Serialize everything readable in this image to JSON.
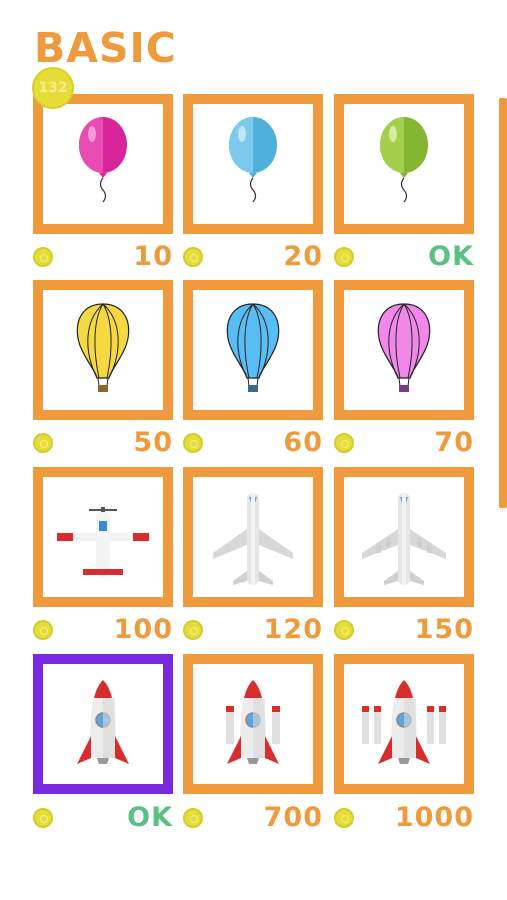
{
  "header": {
    "title": "BASIC",
    "coins": "132"
  },
  "colors": {
    "accent": "#ee9a3d",
    "selected": "#7a28e0",
    "ok": "#5cc080",
    "coin": "#e6dd39"
  },
  "items": [
    {
      "name": "pink-balloon",
      "price": "10",
      "owned": false
    },
    {
      "name": "blue-balloon",
      "price": "20",
      "owned": false
    },
    {
      "name": "green-balloon",
      "price": "OK",
      "owned": true
    },
    {
      "name": "yellow-hot-air-balloon",
      "price": "50",
      "owned": false
    },
    {
      "name": "blue-hot-air-balloon",
      "price": "60",
      "owned": false
    },
    {
      "name": "pink-hot-air-balloon",
      "price": "70",
      "owned": false
    },
    {
      "name": "red-white-propeller-plane",
      "price": "100",
      "owned": false
    },
    {
      "name": "white-jet-plane",
      "price": "120",
      "owned": false
    },
    {
      "name": "white-four-engine-jet",
      "price": "150",
      "owned": false
    },
    {
      "name": "rocket",
      "price": "OK",
      "owned": true,
      "selected": true
    },
    {
      "name": "rocket-two-boosters",
      "price": "700",
      "owned": false
    },
    {
      "name": "rocket-four-boosters",
      "price": "1000",
      "owned": false
    }
  ]
}
